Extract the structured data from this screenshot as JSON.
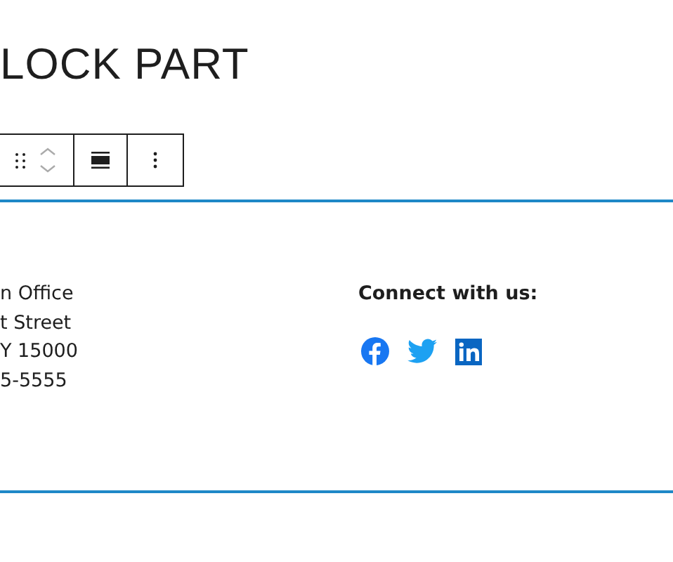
{
  "title": "LOCK PART",
  "address_lines": [
    "n Office",
    "t Street",
    "Y 15000",
    "5-5555"
  ],
  "connect": {
    "heading": "Connect with us:",
    "links": [
      {
        "kind": "facebook"
      },
      {
        "kind": "twitter"
      },
      {
        "kind": "linkedin"
      }
    ]
  }
}
